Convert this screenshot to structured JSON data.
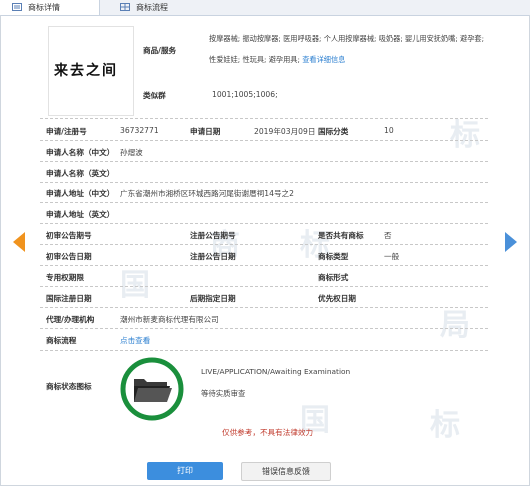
{
  "tabs": {
    "detail": "商标详情",
    "flow": "商标流程"
  },
  "mark": {
    "text": "来去之间"
  },
  "goods": {
    "label": "商品/服务",
    "line1": "按摩器械; 振动按摩器; 医用呼吸器; 个人用按摩器械; 吸奶器; 婴儿用安抚奶嘴; 避孕套;",
    "line2": "性爱娃娃; 性玩具; 避孕用具;",
    "detail_link": "查看详细信息"
  },
  "similar": {
    "label": "类似群",
    "value": "1001;1005;1006;"
  },
  "regno": {
    "label": "申请/注册号",
    "value": "36732771"
  },
  "appdate": {
    "label": "申请日期",
    "value": "2019年03月09日"
  },
  "intclass": {
    "label": "国际分类",
    "value": "10"
  },
  "name_cn": {
    "label": "申请人名称（中文）",
    "value": "孙熠波"
  },
  "name_en": {
    "label": "申请人名称（英文）"
  },
  "addr_cn": {
    "label": "申请人地址（中文）",
    "value": "广东省潮州市湘桥区环城西路河尾街谢厝祠14号之2"
  },
  "addr_en": {
    "label": "申请人地址（英文）"
  },
  "pre_pub_no": {
    "label": "初审公告期号"
  },
  "reg_pub_no": {
    "label": "注册公告期号"
  },
  "shared": {
    "label": "是否共有商标",
    "value": "否"
  },
  "pre_pub_date": {
    "label": "初审公告日期"
  },
  "reg_pub_date": {
    "label": "注册公告日期"
  },
  "type": {
    "label": "商标类型",
    "value": "一般"
  },
  "exclusive": {
    "label": "专用权期限"
  },
  "form": {
    "label": "商标形式"
  },
  "int_reg": {
    "label": "国际注册日期"
  },
  "later_date": {
    "label": "后期指定日期"
  },
  "priority": {
    "label": "优先权日期"
  },
  "agent": {
    "label": "代理/办理机构",
    "value": "潮州市新麦商标代理有限公司"
  },
  "flow": {
    "label": "商标流程",
    "link": "点击查看"
  },
  "status": {
    "label": "商标状态图标",
    "line1": "LIVE/APPLICATION/Awaiting Examination",
    "line2": "等待实质审查",
    "ring_color": "#1a8f3c"
  },
  "disclaimer": "仅供参考，不具有法律效力",
  "buttons": {
    "print": "打印",
    "feedback": "错误信息反馈"
  },
  "colors": {
    "accent": "#2b7fd0",
    "arrow_left": "#f0931e",
    "arrow_right": "#4a90d9",
    "disclaimer": "#c0392b",
    "print_btn": "#3c8ede"
  }
}
